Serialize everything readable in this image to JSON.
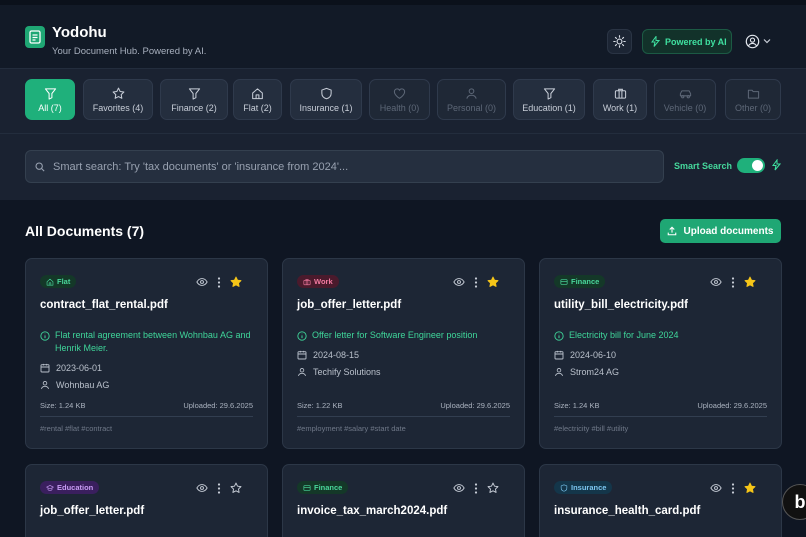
{
  "header": {
    "app_title": "Yodohu",
    "subtitle": "Your Document Hub. Powered by AI.",
    "ai_badge": "Powered by AI"
  },
  "filters": [
    {
      "label": "All (7)",
      "icon": "filter-icon",
      "state": "active"
    },
    {
      "label": "Favorites (4)",
      "icon": "star-icon",
      "state": "normal"
    },
    {
      "label": "Finance (2)",
      "icon": "filter-icon",
      "state": "normal"
    },
    {
      "label": "Flat (2)",
      "icon": "home-icon",
      "state": "normal"
    },
    {
      "label": "Insurance (1)",
      "icon": "shield-icon",
      "state": "normal"
    },
    {
      "label": "Health (0)",
      "icon": "heart-icon",
      "state": "disabled"
    },
    {
      "label": "Personal (0)",
      "icon": "user-icon",
      "state": "disabled"
    },
    {
      "label": "Education (1)",
      "icon": "filter-icon",
      "state": "normal"
    },
    {
      "label": "Work (1)",
      "icon": "briefcase-icon",
      "state": "normal"
    },
    {
      "label": "Vehicle (0)",
      "icon": "car-icon",
      "state": "disabled"
    },
    {
      "label": "Other (0)",
      "icon": "folder-icon",
      "state": "disabled"
    }
  ],
  "search": {
    "placeholder": "Smart search: Try 'tax documents' or 'insurance from 2024'...",
    "smart_label": "Smart Search",
    "smart_enabled": true
  },
  "main": {
    "title": "All Documents (7)",
    "upload_label": "Upload documents"
  },
  "documents": [
    {
      "tag": "Flat",
      "tag_icon": "home-icon",
      "favorite": true,
      "filename": "contract_flat_rental.pdf",
      "description": "Flat rental agreement between Wohnbau AG and Henrik Meier.",
      "date": "2023-06-01",
      "party": "Wohnbau AG",
      "size": "Size: 1.24 KB",
      "uploaded": "Uploaded: 29.6.2025",
      "tags": "#rental #flat #contract"
    },
    {
      "tag": "Work",
      "tag_icon": "briefcase-icon",
      "favorite": true,
      "filename": "job_offer_letter.pdf",
      "description": "Offer letter for Software Engineer position",
      "date": "2024-08-15",
      "party": "Techify Solutions",
      "size": "Size: 1.22 KB",
      "uploaded": "Uploaded: 29.6.2025",
      "tags": "#employment #salary #start date"
    },
    {
      "tag": "Finance",
      "tag_icon": "card-icon",
      "favorite": true,
      "filename": "utility_bill_electricity.pdf",
      "description": "Electricity bill for June 2024",
      "date": "2024-06-10",
      "party": "Strom24 AG",
      "size": "Size: 1.24 KB",
      "uploaded": "Uploaded: 29.6.2025",
      "tags": "#electricity #bill #utility"
    },
    {
      "tag": "Education",
      "tag_icon": "graduation-cap-icon",
      "favorite": false,
      "filename": "job_offer_letter.pdf"
    },
    {
      "tag": "Finance",
      "tag_icon": "card-icon",
      "favorite": false,
      "filename": "invoice_tax_march2024.pdf"
    },
    {
      "tag": "Insurance",
      "tag_icon": "shield-icon",
      "favorite": true,
      "filename": "insurance_health_card.pdf"
    }
  ],
  "colors": {
    "accent": "#1fb07b",
    "background": "#0f1623",
    "star": "#f5c518"
  }
}
